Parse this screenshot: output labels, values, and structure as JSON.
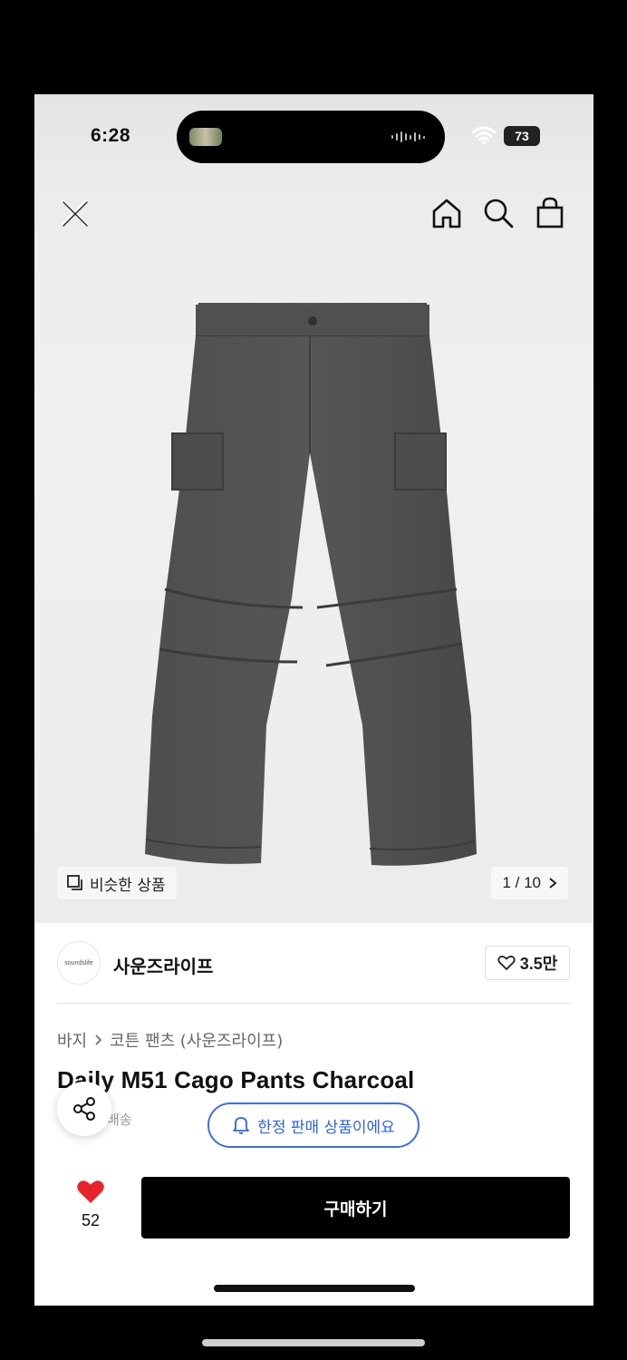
{
  "status_bar": {
    "time": "6:28",
    "battery": "73"
  },
  "navbar": {
    "icons": [
      "close-icon",
      "home-icon",
      "search-icon",
      "shopping-bag-icon"
    ]
  },
  "gallery": {
    "similar_label": "비슷한 상품",
    "page_indicator": "1 / 10"
  },
  "brand": {
    "logo_text": "soundslife",
    "name": "사운즈라이프",
    "like_count": "3.5만"
  },
  "product": {
    "breadcrumb": [
      "바지",
      "코튼 팬츠 (사운즈라이프)"
    ],
    "title": "Daily M51 Cago Pants Charcoal",
    "shipping_fragment": "배송",
    "limited_badge": "한정 판매 상품이에요"
  },
  "bottom_bar": {
    "favorite_count": "52",
    "buy_label": "구매하기"
  },
  "colors": {
    "accent_blue": "#2f64e0",
    "heart_red": "#e8232c",
    "pants_charcoal": "#4a4b4d"
  }
}
